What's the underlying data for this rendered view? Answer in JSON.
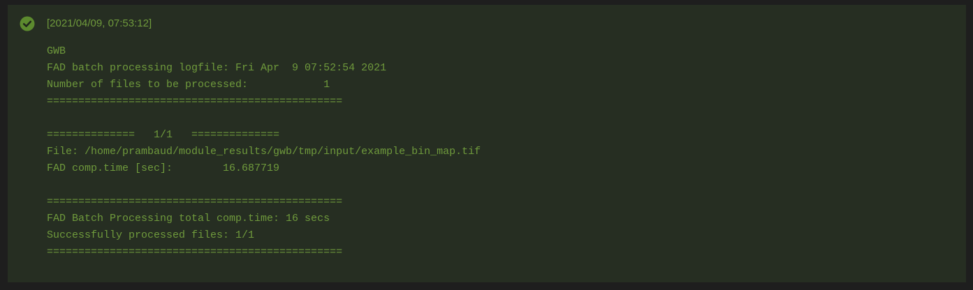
{
  "status": {
    "icon": "check-circle-icon",
    "color": "#5c8a2e",
    "timestamp": "[2021/04/09, 07:53:12]"
  },
  "log": {
    "text_color": "#6f9a3c",
    "lines": [
      "GWB",
      "FAD batch processing logfile: Fri Apr  9 07:52:54 2021",
      "Number of files to be processed:            1",
      "===============================================",
      "",
      "==============   1/1   ==============",
      "File: /home/prambaud/module_results/gwb/tmp/input/example_bin_map.tif",
      "FAD comp.time [sec]:        16.687719",
      "",
      "===============================================",
      "FAD Batch Processing total comp.time: 16 secs",
      "Successfully processed files: 1/1",
      "==============================================="
    ]
  }
}
